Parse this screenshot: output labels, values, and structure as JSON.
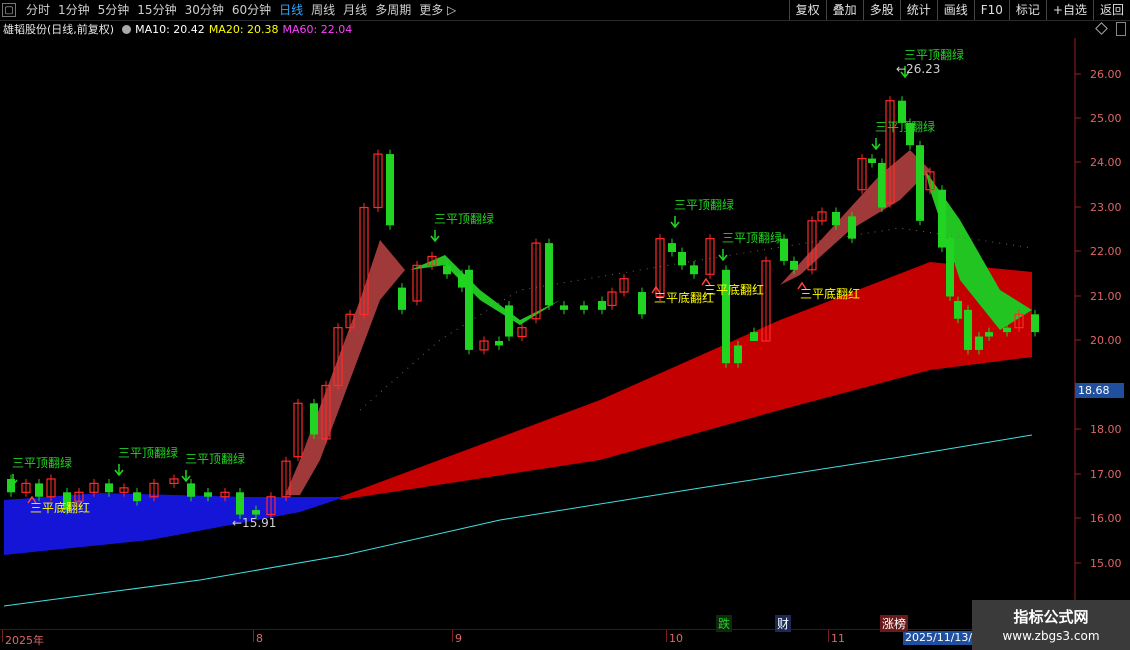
{
  "toolbar": {
    "periods": [
      "分时",
      "1分钟",
      "5分钟",
      "15分钟",
      "30分钟",
      "60分钟",
      "日线",
      "周线",
      "月线",
      "多周期",
      "更多 ▷"
    ],
    "active_period": "日线",
    "right_buttons": [
      "复权",
      "叠加",
      "多股",
      "统计",
      "画线",
      "F10",
      "标记",
      "+自选",
      "返回"
    ]
  },
  "info": {
    "title": "雄韬股份(日线,前复权)",
    "ma10": "MA10: 20.42",
    "ma20": "MA20: 20.38",
    "ma60": "MA60: 22.04"
  },
  "colors": {
    "up": "#ff2a2a",
    "down": "#22d422",
    "ma10": "#ffffff",
    "ma20": "#ffff00",
    "ma60": "#ff40ff",
    "axis": "#e05050",
    "signal_top": "#22d422",
    "signal_bottom": "#ffff00"
  },
  "price_axis": {
    "labels": [
      "26.00",
      "25.00",
      "24.00",
      "23.00",
      "22.00",
      "21.00",
      "20.00",
      "18.68",
      "18.00",
      "17.00",
      "16.00",
      "15.00"
    ],
    "current": "18.68"
  },
  "date_axis": {
    "labels": [
      "2025年",
      "8",
      "9",
      "10",
      "11"
    ],
    "current_date": "2025/11/13/"
  },
  "annotations": {
    "high": "←26.23",
    "low": "←15.91",
    "top_signal": "三平顶翻绿",
    "bottom_signal": "三平底翻红"
  },
  "badges": [
    "跌",
    "财",
    "涨榜"
  ],
  "watermark": {
    "line1": "指标公式网",
    "line2": "www.zbgs3.com"
  }
}
